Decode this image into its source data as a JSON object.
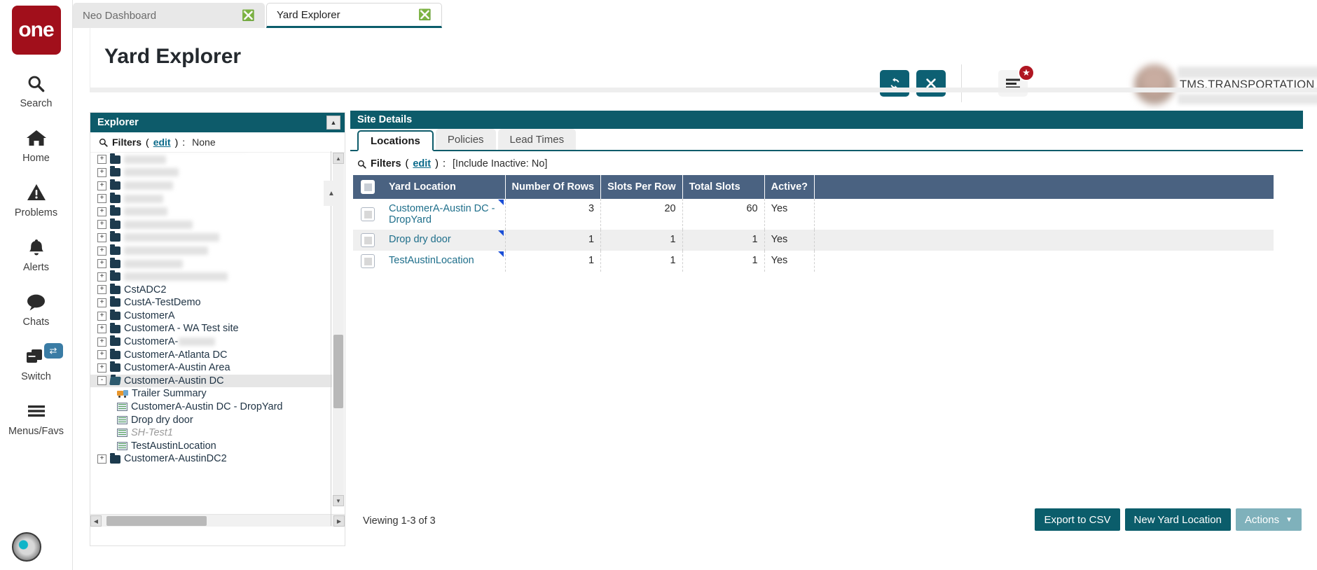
{
  "brand": {
    "logo_text": "one",
    "logo_color": "#a10f1b"
  },
  "theme": {
    "teal": "#0d5b6a",
    "table_header": "#4a6281",
    "link": "#1f6f8b",
    "badge_red": "#b01622"
  },
  "rail": {
    "items": [
      {
        "label": "Search",
        "icon": "search-icon"
      },
      {
        "label": "Home",
        "icon": "home-icon"
      },
      {
        "label": "Problems",
        "icon": "warning-triangle-icon"
      },
      {
        "label": "Alerts",
        "icon": "bell-icon"
      },
      {
        "label": "Chats",
        "icon": "chat-bubble-icon"
      },
      {
        "label": "Switch",
        "icon": "windows-stack-icon",
        "badge_icon": "swap-arrows-icon"
      },
      {
        "label": "Menus/Favs",
        "icon": "hamburger-icon"
      }
    ]
  },
  "tabs": [
    {
      "label": "Neo Dashboard",
      "active": false,
      "close_icon": "close-circle-icon"
    },
    {
      "label": "Yard Explorer",
      "active": true,
      "close_icon": "close-circle-icon"
    }
  ],
  "header": {
    "title": "Yard Explorer",
    "refresh_icon": "refresh-icon",
    "close_icon": "x-icon",
    "hamburger_icon": "hamburger-icon",
    "badge_icon": "star-icon",
    "user_role": "TMS.TRANSPORTATION_MANAGER",
    "caret_icon": "chevron-down-icon"
  },
  "explorer": {
    "title": "Explorer",
    "collapse_icon": "collapse-up-icon",
    "filters": {
      "icon": "search-icon",
      "label": "Filters",
      "edit": "edit",
      "colon": ":",
      "value": "None"
    },
    "tree": [
      {
        "label": "",
        "redacted": true,
        "redact_width": 175,
        "type": "folder",
        "expander": "+",
        "depth": 0
      },
      {
        "label": "",
        "redacted": true,
        "redact_width": 60,
        "type": "folder",
        "expander": "+",
        "depth": 0
      },
      {
        "label": "",
        "redacted": true,
        "redact_width": 78,
        "type": "folder",
        "expander": "+",
        "depth": 0
      },
      {
        "label": "",
        "redacted": true,
        "redact_width": 70,
        "type": "folder",
        "expander": "+",
        "depth": 0
      },
      {
        "label": "",
        "redacted": true,
        "redact_width": 56,
        "type": "folder",
        "expander": "+",
        "depth": 0
      },
      {
        "label": "",
        "redacted": true,
        "redact_width": 62,
        "type": "folder",
        "expander": "+",
        "depth": 0
      },
      {
        "label": "",
        "redacted": true,
        "redact_width": 98,
        "type": "folder",
        "expander": "+",
        "depth": 0
      },
      {
        "label": "",
        "redacted": true,
        "redact_width": 136,
        "type": "folder",
        "expander": "+",
        "depth": 0
      },
      {
        "label": "",
        "redacted": true,
        "redact_width": 120,
        "type": "folder",
        "expander": "+",
        "depth": 0
      },
      {
        "label": "",
        "redacted": true,
        "redact_width": 84,
        "type": "folder",
        "expander": "+",
        "depth": 0
      },
      {
        "label": "",
        "redacted": true,
        "redact_width": 148,
        "type": "folder",
        "expander": "+",
        "depth": 0
      },
      {
        "label": "CstADC2",
        "type": "folder",
        "expander": "+",
        "depth": 0
      },
      {
        "label": "CustA-TestDemo",
        "type": "folder",
        "expander": "+",
        "depth": 0
      },
      {
        "label": "CustomerA",
        "type": "folder",
        "expander": "+",
        "depth": 0
      },
      {
        "label": "CustomerA - WA Test site",
        "type": "folder",
        "expander": "+",
        "depth": 0
      },
      {
        "label": "CustomerA-",
        "redacted_suffix": true,
        "redact_width": 52,
        "type": "folder",
        "expander": "+",
        "depth": 0
      },
      {
        "label": "CustomerA-Atlanta DC",
        "type": "folder",
        "expander": "+",
        "depth": 0
      },
      {
        "label": "CustomerA-Austin Area",
        "type": "folder",
        "expander": "+",
        "depth": 0
      },
      {
        "label": "CustomerA-Austin DC",
        "type": "folder-open",
        "expander": "-",
        "depth": 0,
        "selected": true
      },
      {
        "label": "Trailer Summary",
        "type": "truck",
        "expander": "",
        "depth": 1
      },
      {
        "label": "CustomerA-Austin DC - DropYard",
        "type": "grid",
        "expander": "",
        "depth": 1
      },
      {
        "label": "Drop dry door",
        "type": "grid",
        "expander": "",
        "depth": 1
      },
      {
        "label": "SH-Test1",
        "type": "grid",
        "expander": "",
        "depth": 1,
        "inactive": true
      },
      {
        "label": "TestAustinLocation",
        "type": "grid",
        "expander": "",
        "depth": 1
      },
      {
        "label": "CustomerA-AustinDC2",
        "type": "folder",
        "expander": "+",
        "depth": 0
      }
    ],
    "scroll_up_icon": "scroll-up-arrow-icon",
    "scroll_down_icon": "scroll-down-arrow-icon",
    "scroll_left_icon": "scroll-left-arrow-icon",
    "scroll_right_icon": "scroll-right-arrow-icon"
  },
  "site_details": {
    "title": "Site Details",
    "collapse_icon": "collapse-up-icon",
    "tabs": [
      {
        "label": "Locations",
        "active": true
      },
      {
        "label": "Policies",
        "active": false
      },
      {
        "label": "Lead Times",
        "active": false
      }
    ],
    "filters": {
      "icon": "search-icon",
      "label": "Filters",
      "edit": "edit",
      "colon": ":",
      "value": "[Include Inactive: No]"
    },
    "table": {
      "columns": [
        "Yard Location",
        "Number Of Rows",
        "Slots Per Row",
        "Total Slots",
        "Active?"
      ],
      "rows": [
        {
          "yard_location": "CustomerA-Austin DC - DropYard",
          "number_of_rows": "3",
          "slots_per_row": "20",
          "total_slots": "60",
          "active": "Yes"
        },
        {
          "yard_location": "Drop dry door",
          "number_of_rows": "1",
          "slots_per_row": "1",
          "total_slots": "1",
          "active": "Yes"
        },
        {
          "yard_location": "TestAustinLocation",
          "number_of_rows": "1",
          "slots_per_row": "1",
          "total_slots": "1",
          "active": "Yes"
        }
      ]
    },
    "viewing": "Viewing 1-3 of 3",
    "buttons": {
      "export": "Export to CSV",
      "new_yard_location": "New Yard Location",
      "actions": "Actions",
      "actions_caret_icon": "caret-down-icon"
    }
  }
}
